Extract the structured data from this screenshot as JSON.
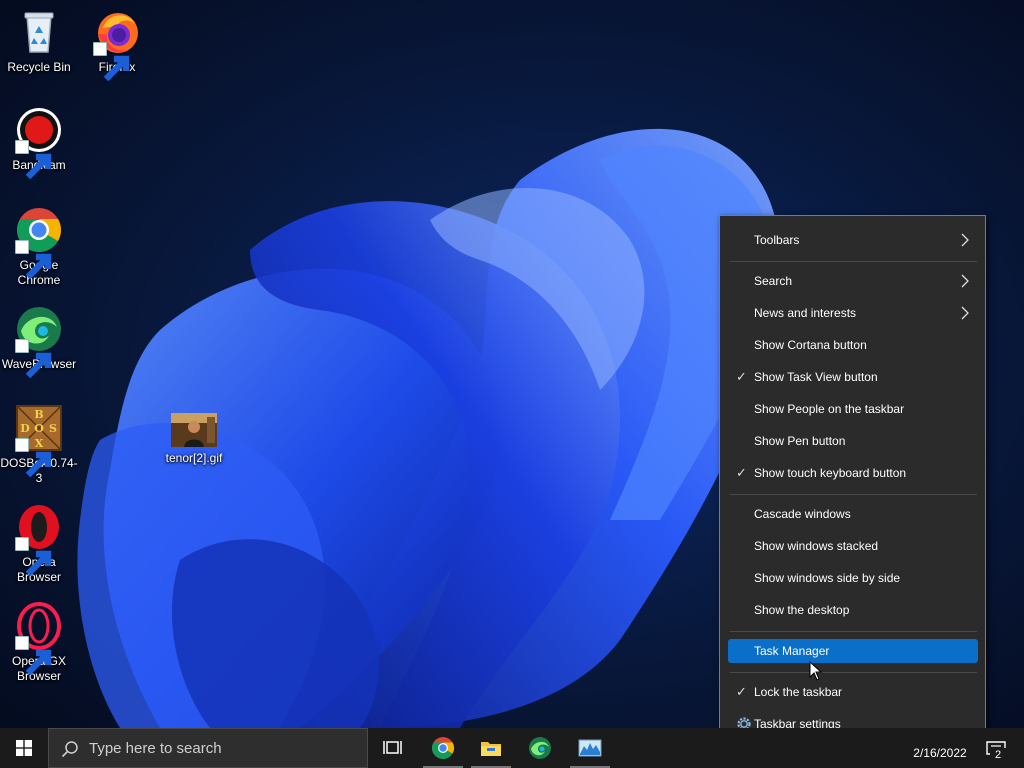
{
  "desktop": {
    "icons": [
      {
        "label": "Recycle Bin",
        "icon": "recycle-bin-icon"
      },
      {
        "label": "Firefox",
        "icon": "firefox-icon"
      },
      {
        "label": "Bandicam",
        "icon": "bandicam-icon"
      },
      {
        "label": "Google Chrome",
        "icon": "chrome-icon"
      },
      {
        "label": "WaveBrowser",
        "icon": "wavebrowser-icon"
      },
      {
        "label": "DOSBox 0.74-3",
        "icon": "dosbox-icon"
      },
      {
        "label": "tenor[2].gif",
        "icon": "gif-thumbnail-icon"
      },
      {
        "label": "Opera Browser",
        "icon": "opera-icon"
      },
      {
        "label": "Opera GX Browser",
        "icon": "opera-gx-icon"
      }
    ],
    "dosbox_logo_letters": [
      "B",
      "D",
      "O",
      "S",
      "X"
    ]
  },
  "context_menu": {
    "items": [
      {
        "label": "Toolbars",
        "submenu": true,
        "checked": false
      },
      {
        "label": "Search",
        "submenu": true,
        "checked": false
      },
      {
        "label": "News and interests",
        "submenu": true,
        "checked": false
      },
      {
        "label": "Show Cortana button",
        "submenu": false,
        "checked": false
      },
      {
        "label": "Show Task View button",
        "submenu": false,
        "checked": true
      },
      {
        "label": "Show People on the taskbar",
        "submenu": false,
        "checked": false
      },
      {
        "label": "Show Pen button",
        "submenu": false,
        "checked": false
      },
      {
        "label": "Show touch keyboard button",
        "submenu": false,
        "checked": true
      },
      {
        "label": "Cascade windows",
        "submenu": false,
        "checked": false
      },
      {
        "label": "Show windows stacked",
        "submenu": false,
        "checked": false
      },
      {
        "label": "Show windows side by side",
        "submenu": false,
        "checked": false
      },
      {
        "label": "Show the desktop",
        "submenu": false,
        "checked": false
      },
      {
        "label": "Task Manager",
        "submenu": false,
        "checked": false,
        "highlighted": true
      },
      {
        "label": "Lock the taskbar",
        "submenu": false,
        "checked": true
      },
      {
        "label": "Taskbar settings",
        "submenu": false,
        "checked": false,
        "icon": "gear-icon"
      }
    ],
    "check_glyph": "✓"
  },
  "taskbar": {
    "search_placeholder": "Type here to search",
    "pinned": [
      "task-view-icon",
      "chrome-icon",
      "file-explorer-icon",
      "wavebrowser-icon",
      "resource-monitor-icon"
    ],
    "date": "2/16/2022",
    "notification_count": "2"
  },
  "colors": {
    "menu_bg": "#2b2b2b",
    "menu_highlight": "#0a6fc9",
    "taskbar_bg": "#1b1b1b"
  }
}
